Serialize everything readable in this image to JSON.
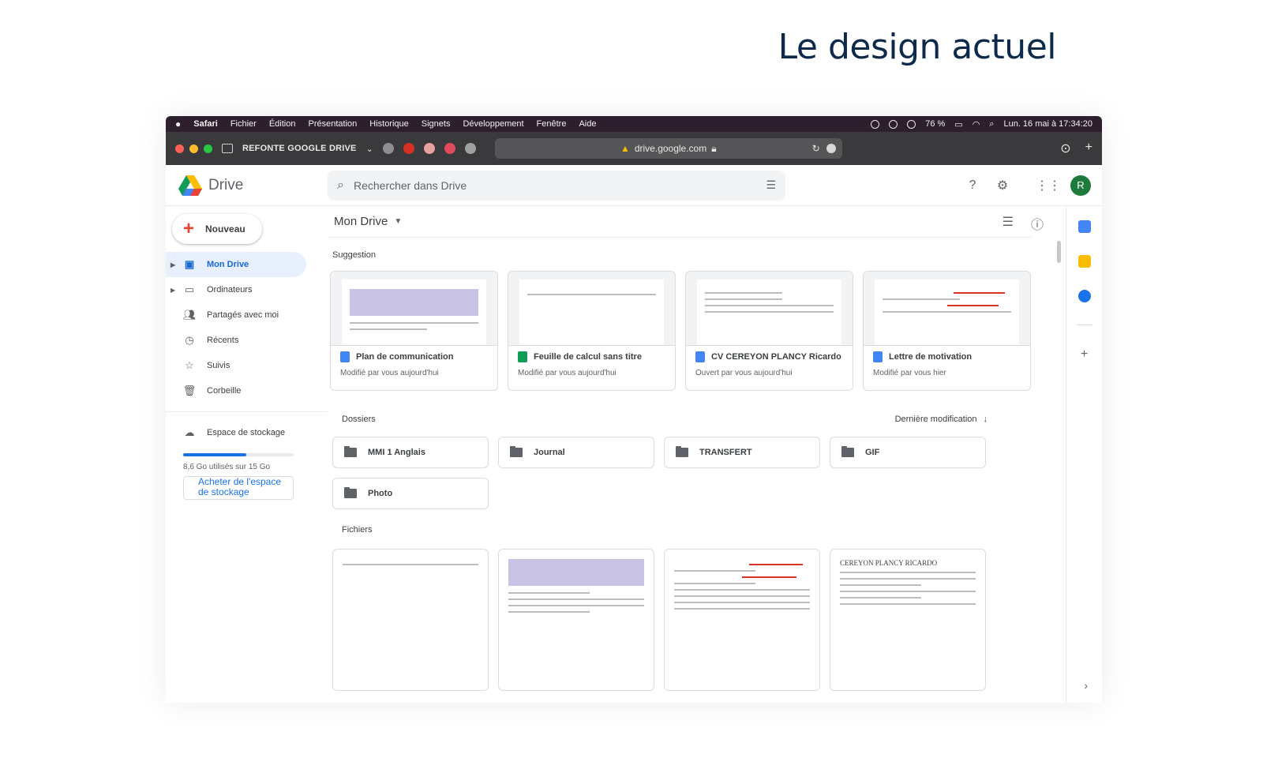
{
  "heading": "Le design actuel",
  "menubar": {
    "items": [
      "Safari",
      "Fichier",
      "Édition",
      "Présentation",
      "Historique",
      "Signets",
      "Développement",
      "Fenêtre",
      "Aide"
    ],
    "battery": "76 %",
    "clock": "Lun. 16 mai à 17:34:20"
  },
  "toolbar": {
    "tab_title": "REFONTE GOOGLE DRIVE",
    "url": "drive.google.com"
  },
  "drive": {
    "logo_text": "Drive",
    "search_placeholder": "Rechercher dans Drive",
    "avatar_letter": "R",
    "new_button": "Nouveau",
    "nav": [
      "Mon Drive",
      "Ordinateurs",
      "Partagés avec moi",
      "Récents",
      "Suivis",
      "Corbeille"
    ],
    "storage_label": "Espace de stockage",
    "storage_used_fraction": 0.57,
    "storage_text": "8,6 Go utilisés sur 15 Go",
    "buy_storage": "Acheter de l'espace de stockage",
    "page_title": "Mon Drive",
    "suggestion_label": "Suggestion",
    "suggestions": [
      {
        "name": "Plan de communication",
        "meta": "Modifié par vous aujourd'hui",
        "type": "doc"
      },
      {
        "name": "Feuille de calcul sans titre",
        "meta": "Modifié par vous aujourd'hui",
        "type": "sheet"
      },
      {
        "name": "CV CEREYON PLANCY Ricardo",
        "meta": "Ouvert par vous aujourd'hui",
        "type": "doc"
      },
      {
        "name": "Lettre de motivation",
        "meta": "Modifié par vous hier",
        "type": "doc"
      }
    ],
    "folders_label": "Dossiers",
    "sort_label": "Dernière modification",
    "folders": [
      "MMI 1 Anglais",
      "Journal",
      "TRANSFERT",
      "GIF",
      "Photo"
    ],
    "files_label": "Fichiers",
    "cv_heading": "CEREYON PLANCY RICARDO"
  },
  "colors": {
    "accent": "#1a73e8",
    "active_bg": "#e8f0fe",
    "menubar": "#2d1f2e",
    "toolbar": "#3a3a3c"
  }
}
